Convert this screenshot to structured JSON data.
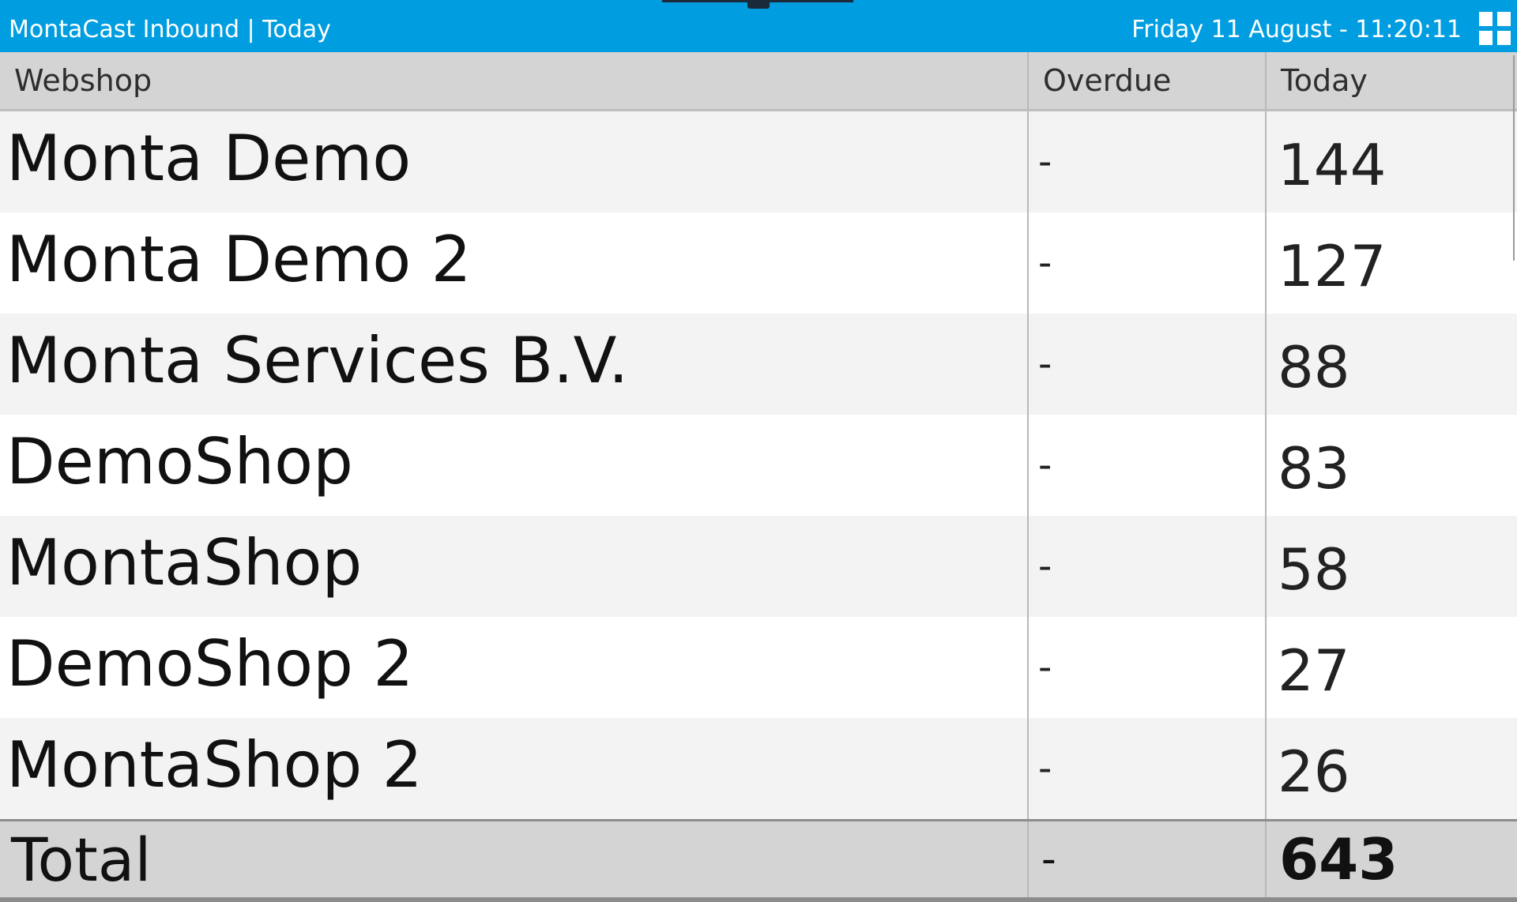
{
  "header": {
    "title": "MontaCast Inbound | Today",
    "datetime": "Friday 11 August - 11:20:11",
    "menu_icon": "grid-menu-icon",
    "background_color": "#009ee0"
  },
  "table": {
    "columns": [
      "Webshop",
      "Overdue",
      "Today"
    ],
    "rows": [
      {
        "webshop": "Monta Demo",
        "overdue": "-",
        "today": "144"
      },
      {
        "webshop": "Monta Demo 2",
        "overdue": "-",
        "today": "127"
      },
      {
        "webshop": "Monta Services B.V.",
        "overdue": "-",
        "today": "88"
      },
      {
        "webshop": "DemoShop",
        "overdue": "-",
        "today": "83"
      },
      {
        "webshop": "MontaShop",
        "overdue": "-",
        "today": "58"
      },
      {
        "webshop": "DemoShop 2",
        "overdue": "-",
        "today": "27"
      },
      {
        "webshop": "MontaShop 2",
        "overdue": "-",
        "today": "26"
      }
    ],
    "total": {
      "label": "Total",
      "overdue": "-",
      "today": "643"
    }
  }
}
